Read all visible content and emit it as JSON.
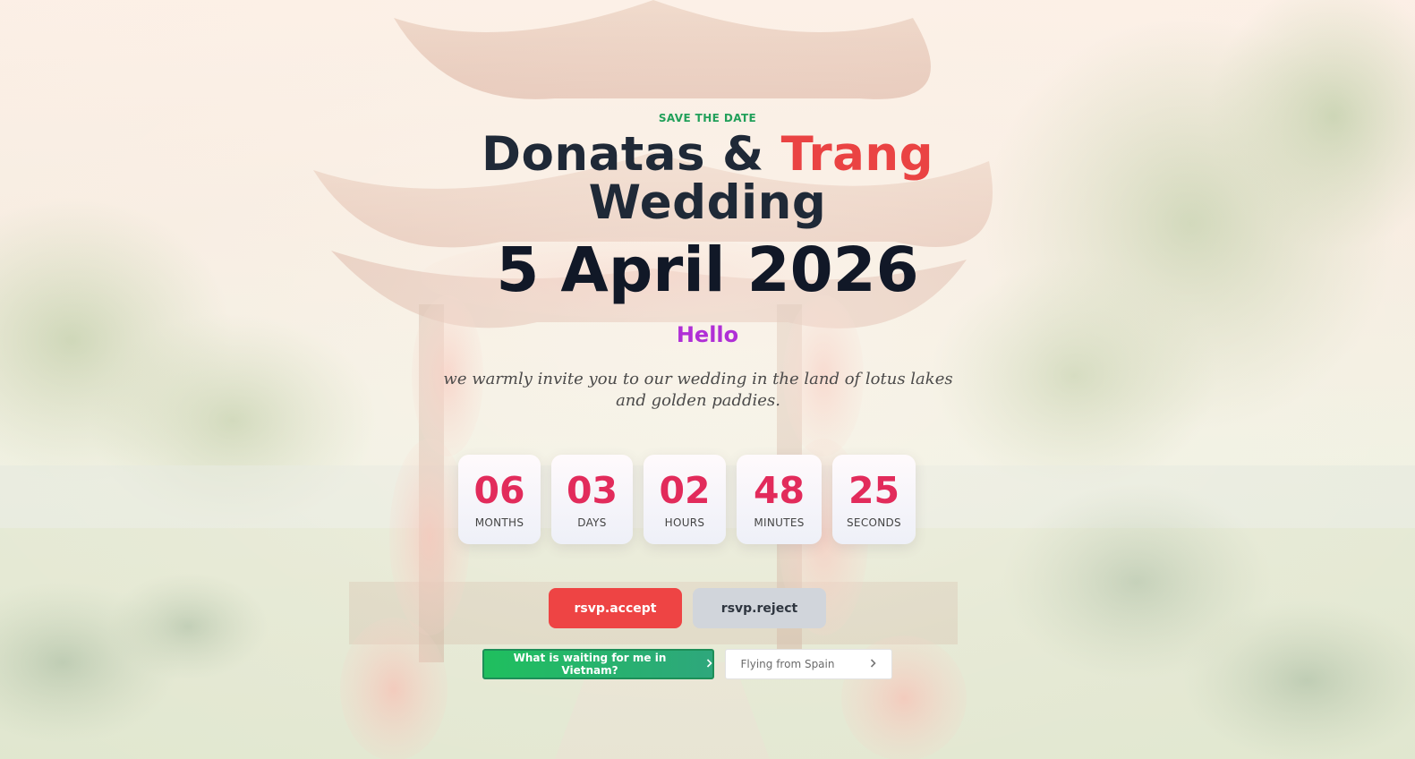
{
  "header": {
    "eyebrow": "SAVE THE DATE",
    "names_part1": "Donatas & ",
    "names_part2": "Trang",
    "title_line2": "Wedding",
    "date": "5 April 2026"
  },
  "greeting": "Hello",
  "invitation": "we warmly invite you to our wedding in the land of lotus lakes and golden paddies.",
  "countdown": [
    {
      "value": "06",
      "label": "MONTHS"
    },
    {
      "value": "03",
      "label": "DAYS"
    },
    {
      "value": "02",
      "label": "HOURS"
    },
    {
      "value": "48",
      "label": "MINUTES"
    },
    {
      "value": "25",
      "label": "SECONDS"
    }
  ],
  "rsvp": {
    "accept_label": "rsvp.accept",
    "reject_label": "rsvp.reject"
  },
  "links": {
    "vietnam_label": "What is waiting for me in Vietnam?",
    "spain_label": "Flying from Spain",
    "vietnam_icon": "chevron-right-icon",
    "spain_icon": "chevron-right-icon"
  },
  "colors": {
    "accent_red": "#ee4444",
    "eyebrow_green": "#22a05a",
    "greeting_purple": "#b02fd6",
    "countdown_number": "#e22b5b"
  }
}
